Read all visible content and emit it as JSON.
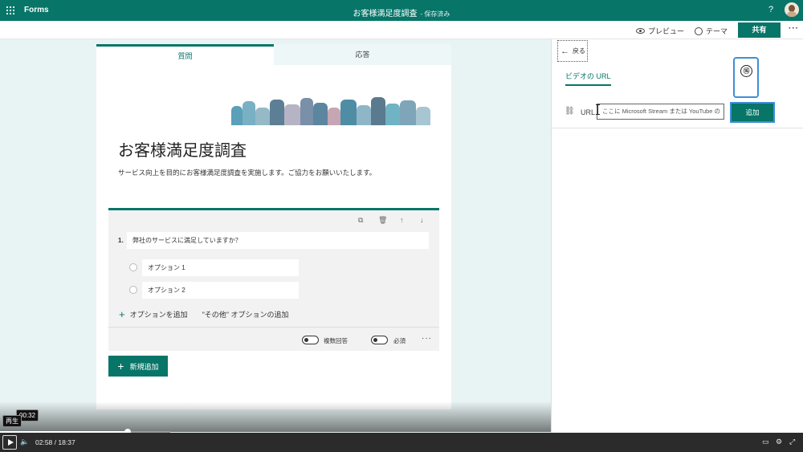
{
  "topbar": {
    "app_name": "Forms",
    "form_title": "お客様満足度調査",
    "saved_status": "- 保存済み",
    "help": "?"
  },
  "commandbar": {
    "preview": "プレビュー",
    "theme": "テーマ",
    "share": "共有",
    "more": "···"
  },
  "tabs": {
    "questions": "質問",
    "responses": "応答"
  },
  "form": {
    "title": "お客様満足度調査",
    "description": "サービス向上を目的にお客様満足度調査を実施します。ご協力をお願いいたします。"
  },
  "question": {
    "number": "1.",
    "text": "弊社のサービスに満足していますか？",
    "options": [
      "オプション 1",
      "オプション 2"
    ],
    "add_option": "オプションを追加",
    "add_other": "\"その他\" オプションの追加",
    "multiple_answers": "複数回答",
    "required": "必須",
    "more": "···"
  },
  "new_button": "新規追加",
  "panel": {
    "back": "戻る",
    "video_tab": "ビデオの URL",
    "url_label": "URL",
    "url_placeholder": "ここに Microsoft Stream または YouTube の",
    "add_button": "追加",
    "callout_number": "⑯"
  },
  "player": {
    "hover_time": "00:32",
    "play_tooltip": "再生",
    "current_time": "02:58",
    "separator": "/",
    "total_time": "18:37",
    "progress": 0.159
  },
  "icons": {
    "waffle": "app-launcher-icon",
    "preview": "eye-icon",
    "theme": "palette-icon",
    "copy": "copy-icon",
    "delete": "trash-icon",
    "up": "arrow-up-icon",
    "down": "arrow-down-icon"
  },
  "colors": {
    "brand": "#077568",
    "highlight": "#3f8fd6",
    "canvas": "#e8f3f3"
  }
}
